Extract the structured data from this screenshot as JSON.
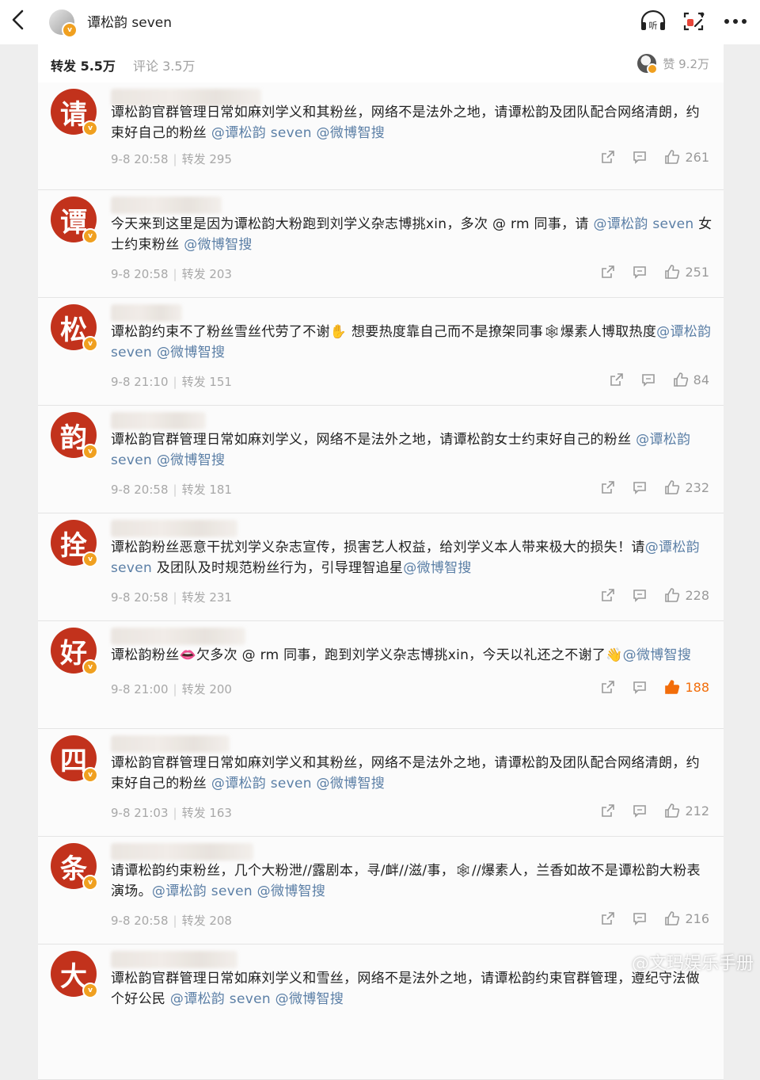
{
  "header": {
    "title": "谭松韵 seven",
    "icons": [
      "back-icon",
      "listen-icon",
      "scan-icon",
      "more-icon"
    ],
    "listen_label": "听"
  },
  "tabs": {
    "repost": "转发 5.5万",
    "comment": "评论 3.5万",
    "likes": "赞 9.2万"
  },
  "colors": {
    "mention": "#5b7fa6",
    "avatar_red": "#c2321c",
    "like_active": "#f26d0a",
    "verified": "#f0a020"
  },
  "comments": [
    {
      "avatar": "请",
      "text": [
        {
          "t": "谭松韵官群管理日常如麻刘学义和其粉丝，网络不是法外之地，请谭松韵及团队配合网络清朗，约束好自己的粉丝 "
        },
        {
          "m": "@谭松韵 seven"
        },
        {
          "t": " "
        },
        {
          "m": "@微博智搜"
        }
      ],
      "time": "9-8 20:58",
      "reposts": "转发 295",
      "likes": "261"
    },
    {
      "avatar": "谭",
      "text": [
        {
          "t": "今天来到这里是因为谭松韵大粉跑到刘学义杂志博挑xin，多次 @ rm 同事，请 "
        },
        {
          "m": "@谭松韵 seven"
        },
        {
          "t": " 女士约束粉丝 "
        },
        {
          "m": "@微博智搜"
        }
      ],
      "time": "9-8 20:58",
      "reposts": "转发 203",
      "likes": "251"
    },
    {
      "avatar": "松",
      "text": [
        {
          "t": "谭松韵约束不了粉丝雪丝代劳了不谢✋ 想要热度靠自己而不是撩架同事🕸爆素人博取热度"
        },
        {
          "m": "@谭松韵 seven"
        },
        {
          "t": " "
        },
        {
          "m": "@微博智搜"
        }
      ],
      "time": "9-8 21:10",
      "reposts": "转发 151",
      "likes": "84"
    },
    {
      "avatar": "韵",
      "text": [
        {
          "t": "谭松韵官群管理日常如麻刘学义，网络不是法外之地，请谭松韵女士约束好自己的粉丝 "
        },
        {
          "m": "@谭松韵 seven"
        },
        {
          "t": " "
        },
        {
          "m": "@微博智搜"
        }
      ],
      "time": "9-8 20:58",
      "reposts": "转发 181",
      "likes": "232"
    },
    {
      "avatar": "拴",
      "text": [
        {
          "t": "谭松韵粉丝恶意干扰刘学义杂志宣传，损害艺人权益，给刘学义本人带来极大的损失！请"
        },
        {
          "m": "@谭松韵 seven"
        },
        {
          "t": " 及团队及时规范粉丝行为，引导理智追星"
        },
        {
          "m": "@微博智搜"
        }
      ],
      "time": "9-8 20:58",
      "reposts": "转发 231",
      "likes": "228"
    },
    {
      "avatar": "好",
      "text": [
        {
          "t": "谭松韵粉丝👄欠多次 @ rm 同事，跑到刘学义杂志博挑xin，今天以礼还之不谢了👋"
        },
        {
          "m": "@微博智搜"
        }
      ],
      "time": "9-8 21:00",
      "reposts": "转发 200",
      "likes": "188",
      "liked": true
    },
    {
      "avatar": "四",
      "text": [
        {
          "t": "谭松韵官群管理日常如麻刘学义和其粉丝，网络不是法外之地，请谭松韵及团队配合网络清朗，约束好自己的粉丝 "
        },
        {
          "m": "@谭松韵 seven"
        },
        {
          "t": " "
        },
        {
          "m": "@微博智搜"
        }
      ],
      "time": "9-8 21:03",
      "reposts": "转发 163",
      "likes": "212"
    },
    {
      "avatar": "条",
      "text": [
        {
          "t": "请谭松韵约束粉丝，几个大粉泄//露剧本，寻/衅//滋/事，🕸//爆素人，兰香如故不是谭松韵大粉表演场。"
        },
        {
          "m": "@谭松韵 seven"
        },
        {
          "t": " "
        },
        {
          "m": "@微博智搜"
        }
      ],
      "time": "9-8 20:58",
      "reposts": "转发 208",
      "likes": "216"
    },
    {
      "avatar": "大",
      "text": [
        {
          "t": "谭松韵官群管理日常如麻刘学义和雪丝，网络不是法外之地，请谭松韵约束官群管理，遵纪守法做个好公民 "
        },
        {
          "m": "@谭松韵 seven"
        },
        {
          "t": " "
        },
        {
          "m": "@微博智搜"
        }
      ],
      "time": "",
      "reposts": "",
      "likes": ""
    }
  ],
  "watermark": "@文玛娱乐手册"
}
